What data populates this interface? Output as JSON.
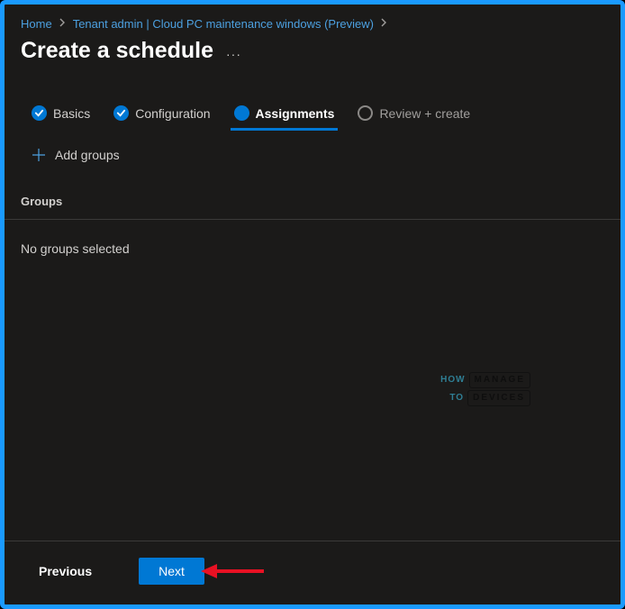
{
  "breadcrumb": {
    "home": "Home",
    "section": "Tenant admin | Cloud PC maintenance windows (Preview)"
  },
  "page": {
    "title": "Create a schedule"
  },
  "tabs": {
    "basics": "Basics",
    "configuration": "Configuration",
    "assignments": "Assignments",
    "review": "Review + create"
  },
  "actions": {
    "add_groups": "Add groups"
  },
  "groups": {
    "header": "Groups",
    "empty": "No groups selected"
  },
  "footer": {
    "previous": "Previous",
    "next": "Next"
  },
  "watermark": {
    "l1a": "HOW",
    "l1b": "MANAGE",
    "l2a": "TO",
    "l2b": "DEVICES"
  },
  "colors": {
    "accent": "#0078d4",
    "link": "#4ca0e0",
    "bg": "#1b1a19"
  }
}
